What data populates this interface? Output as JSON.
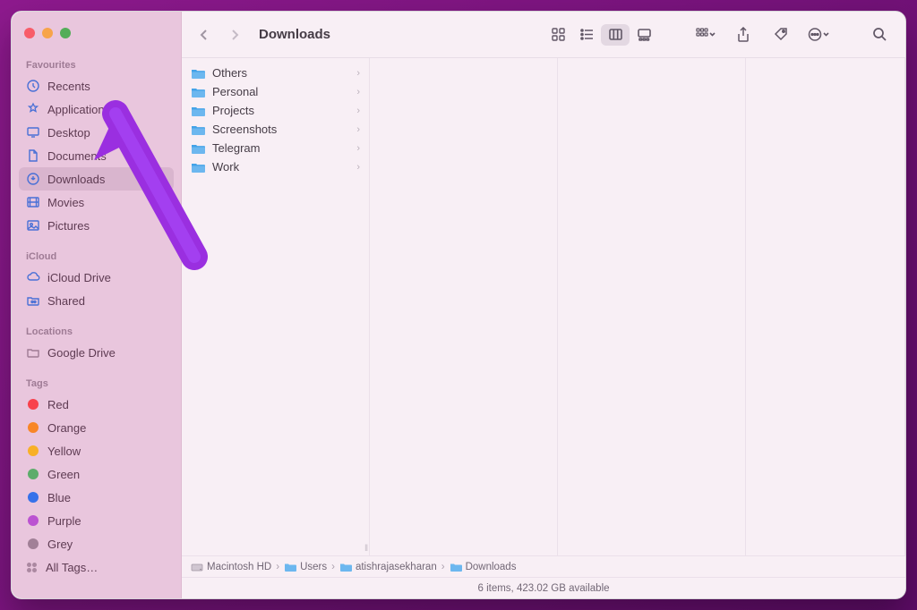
{
  "window_title": "Downloads",
  "sidebar": {
    "sections": {
      "favourites": {
        "header": "Favourites",
        "items": [
          {
            "icon": "recents",
            "label": "Recents"
          },
          {
            "icon": "applications",
            "label": "Applications"
          },
          {
            "icon": "desktop",
            "label": "Desktop"
          },
          {
            "icon": "documents",
            "label": "Documents"
          },
          {
            "icon": "downloads",
            "label": "Downloads",
            "selected": true
          },
          {
            "icon": "movies",
            "label": "Movies"
          },
          {
            "icon": "pictures",
            "label": "Pictures"
          }
        ]
      },
      "icloud": {
        "header": "iCloud",
        "items": [
          {
            "icon": "icloud",
            "label": "iCloud Drive"
          },
          {
            "icon": "shared",
            "label": "Shared"
          }
        ]
      },
      "locations": {
        "header": "Locations",
        "items": [
          {
            "icon": "folder",
            "label": "Google Drive"
          }
        ]
      },
      "tags": {
        "header": "Tags",
        "items": [
          {
            "color": "#ff3b30",
            "label": "Red"
          },
          {
            "color": "#ff9500",
            "label": "Orange"
          },
          {
            "color": "#ffcc00",
            "label": "Yellow"
          },
          {
            "color": "#34c759",
            "label": "Green"
          },
          {
            "color": "#007aff",
            "label": "Blue"
          },
          {
            "color": "#af52de",
            "label": "Purple"
          },
          {
            "color": "#8e8e93",
            "label": "Grey"
          }
        ],
        "all_label": "All Tags…"
      }
    }
  },
  "toolbar": {
    "view_mode": "columns"
  },
  "columns": [
    {
      "items": [
        {
          "label": "Others"
        },
        {
          "label": "Personal"
        },
        {
          "label": "Projects"
        },
        {
          "label": "Screenshots"
        },
        {
          "label": "Telegram"
        },
        {
          "label": "Work"
        }
      ]
    },
    {
      "items": []
    },
    {
      "items": []
    },
    {
      "items": []
    }
  ],
  "pathbar": [
    {
      "icon": "disk",
      "label": "Macintosh HD"
    },
    {
      "icon": "folder",
      "label": "Users"
    },
    {
      "icon": "folder",
      "label": "atishrajasekharan"
    },
    {
      "icon": "folder",
      "label": "Downloads"
    }
  ],
  "status": "6 items, 423.02 GB available"
}
